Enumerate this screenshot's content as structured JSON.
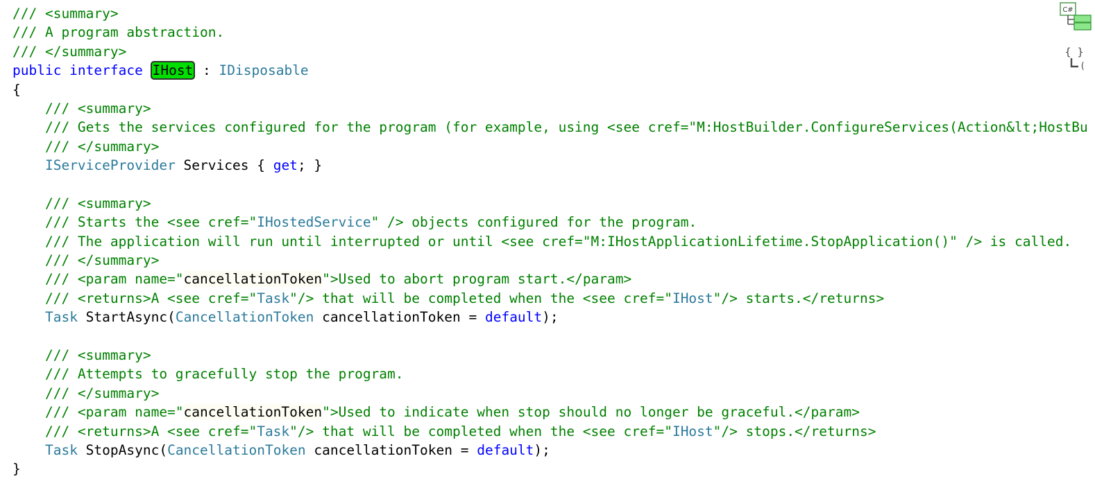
{
  "editor": {
    "language": "C#",
    "file_symbol": "IHost",
    "background_color": "#ffffff",
    "colors": {
      "keyword": "#0000ff",
      "type": "#2b7a9b",
      "comment": "#008000",
      "plain": "#000000",
      "highlight_background": "#00e000",
      "highlight_border": "#303030",
      "xml_name_background": "#fdfdf3"
    }
  },
  "gutter": {
    "icons": [
      {
        "name": "csharp-codemap-icon",
        "label": "C#"
      },
      {
        "name": "braces-structure-icon",
        "label": "{ }"
      }
    ]
  },
  "code": {
    "lines": [
      {
        "index": 1,
        "indent": 0,
        "text": "/// <summary>",
        "tokens": [
          {
            "kind": "comment",
            "text": "/// <summary>"
          }
        ]
      },
      {
        "index": 2,
        "indent": 0,
        "text": "/// A program abstraction.",
        "tokens": [
          {
            "kind": "comment",
            "text": "/// A program abstraction."
          }
        ]
      },
      {
        "index": 3,
        "indent": 0,
        "text": "/// </summary>",
        "tokens": [
          {
            "kind": "comment",
            "text": "/// </summary>"
          }
        ]
      },
      {
        "index": 4,
        "indent": 0,
        "text": "public interface IHost : IDisposable",
        "tokens": [
          {
            "kind": "keyword",
            "text": "public interface "
          },
          {
            "kind": "highlight",
            "text": "IHost"
          },
          {
            "kind": "plain",
            "text": " : "
          },
          {
            "kind": "type",
            "text": "IDisposable"
          }
        ]
      },
      {
        "index": 5,
        "indent": 0,
        "text": "{",
        "tokens": [
          {
            "kind": "plain",
            "text": "{"
          }
        ]
      },
      {
        "index": 6,
        "indent": 1,
        "text": "    /// <summary>",
        "tokens": [
          {
            "kind": "comment",
            "text": "    /// <summary>"
          }
        ]
      },
      {
        "index": 7,
        "indent": 1,
        "text": "    /// Gets the services configured for the program (for example, using <see cref=\"M:HostBuilder.ConfigureServices(Action&lt;HostBu",
        "tokens": [
          {
            "kind": "comment",
            "text": "    /// Gets the services configured for the program (for example, using <see cref=\"M:HostBuilder.ConfigureServices(Action&lt;HostBu"
          }
        ]
      },
      {
        "index": 8,
        "indent": 1,
        "text": "    /// </summary>",
        "tokens": [
          {
            "kind": "comment",
            "text": "    /// </summary>"
          }
        ]
      },
      {
        "index": 9,
        "indent": 1,
        "text": "    IServiceProvider Services { get; }",
        "tokens": [
          {
            "kind": "plain",
            "text": "    "
          },
          {
            "kind": "type",
            "text": "IServiceProvider"
          },
          {
            "kind": "plain",
            "text": " Services { "
          },
          {
            "kind": "keyword",
            "text": "get"
          },
          {
            "kind": "plain",
            "text": "; }"
          }
        ]
      },
      {
        "index": 10,
        "indent": 0,
        "text": "",
        "tokens": []
      },
      {
        "index": 11,
        "indent": 1,
        "text": "    /// <summary>",
        "tokens": [
          {
            "kind": "comment",
            "text": "    /// <summary>"
          }
        ]
      },
      {
        "index": 12,
        "indent": 1,
        "text": "    /// Starts the <see cref=\"IHostedService\" /> objects configured for the program.",
        "tokens": [
          {
            "kind": "comment",
            "text": "    /// Starts the <see cref=\""
          },
          {
            "kind": "cref",
            "text": "IHostedService"
          },
          {
            "kind": "comment",
            "text": "\" /> objects configured for the program."
          }
        ]
      },
      {
        "index": 13,
        "indent": 1,
        "text": "    /// The application will run until interrupted or until <see cref=\"M:IHostApplicationLifetime.StopApplication()\" /> is called.",
        "tokens": [
          {
            "kind": "comment",
            "text": "    /// The application will run until interrupted or until <see cref=\"M:IHostApplicationLifetime.StopApplication()\" /> is called."
          }
        ]
      },
      {
        "index": 14,
        "indent": 1,
        "text": "    /// </summary>",
        "tokens": [
          {
            "kind": "comment",
            "text": "    /// </summary>"
          }
        ]
      },
      {
        "index": 15,
        "indent": 1,
        "text": "    /// <param name=\"cancellationToken\">Used to abort program start.</param>",
        "tokens": [
          {
            "kind": "comment",
            "text": "    /// <param name=\""
          },
          {
            "kind": "xmlname",
            "text": "cancellationToken"
          },
          {
            "kind": "comment",
            "text": "\">Used to abort program start.</param>"
          }
        ]
      },
      {
        "index": 16,
        "indent": 1,
        "text": "    /// <returns>A <see cref=\"Task\"/> that will be completed when the <see cref=\"IHost\"/> starts.</returns>",
        "tokens": [
          {
            "kind": "comment",
            "text": "    /// <returns>A <see cref=\""
          },
          {
            "kind": "cref",
            "text": "Task"
          },
          {
            "kind": "comment",
            "text": "\"/> that will be completed when the <see cref=\""
          },
          {
            "kind": "cref",
            "text": "IHost"
          },
          {
            "kind": "comment",
            "text": "\"/> starts.</returns>"
          }
        ]
      },
      {
        "index": 17,
        "indent": 1,
        "text": "    Task StartAsync(CancellationToken cancellationToken = default);",
        "tokens": [
          {
            "kind": "plain",
            "text": "    "
          },
          {
            "kind": "type",
            "text": "Task"
          },
          {
            "kind": "plain",
            "text": " StartAsync("
          },
          {
            "kind": "type",
            "text": "CancellationToken"
          },
          {
            "kind": "plain",
            "text": " cancellationToken = "
          },
          {
            "kind": "keyword",
            "text": "default"
          },
          {
            "kind": "plain",
            "text": ");"
          }
        ]
      },
      {
        "index": 18,
        "indent": 0,
        "text": "",
        "tokens": []
      },
      {
        "index": 19,
        "indent": 1,
        "text": "    /// <summary>",
        "tokens": [
          {
            "kind": "comment",
            "text": "    /// <summary>"
          }
        ]
      },
      {
        "index": 20,
        "indent": 1,
        "text": "    /// Attempts to gracefully stop the program.",
        "tokens": [
          {
            "kind": "comment",
            "text": "    /// Attempts to gracefully stop the program."
          }
        ]
      },
      {
        "index": 21,
        "indent": 1,
        "text": "    /// </summary>",
        "tokens": [
          {
            "kind": "comment",
            "text": "    /// </summary>"
          }
        ]
      },
      {
        "index": 22,
        "indent": 1,
        "text": "    /// <param name=\"cancellationToken\">Used to indicate when stop should no longer be graceful.</param>",
        "tokens": [
          {
            "kind": "comment",
            "text": "    /// <param name=\""
          },
          {
            "kind": "xmlname",
            "text": "cancellationToken"
          },
          {
            "kind": "comment",
            "text": "\">Used to indicate when stop should no longer be graceful.</param>"
          }
        ]
      },
      {
        "index": 23,
        "indent": 1,
        "text": "    /// <returns>A <see cref=\"Task\"/> that will be completed when the <see cref=\"IHost\"/> stops.</returns>",
        "tokens": [
          {
            "kind": "comment",
            "text": "    /// <returns>A <see cref=\""
          },
          {
            "kind": "cref",
            "text": "Task"
          },
          {
            "kind": "comment",
            "text": "\"/> that will be completed when the <see cref=\""
          },
          {
            "kind": "cref",
            "text": "IHost"
          },
          {
            "kind": "comment",
            "text": "\"/> stops.</returns>"
          }
        ]
      },
      {
        "index": 24,
        "indent": 1,
        "text": "    Task StopAsync(CancellationToken cancellationToken = default);",
        "tokens": [
          {
            "kind": "plain",
            "text": "    "
          },
          {
            "kind": "type",
            "text": "Task"
          },
          {
            "kind": "plain",
            "text": " StopAsync("
          },
          {
            "kind": "type",
            "text": "CancellationToken"
          },
          {
            "kind": "plain",
            "text": " cancellationToken = "
          },
          {
            "kind": "keyword",
            "text": "default"
          },
          {
            "kind": "plain",
            "text": ");"
          }
        ]
      },
      {
        "index": 25,
        "indent": 0,
        "text": "}",
        "tokens": [
          {
            "kind": "plain",
            "text": "}"
          }
        ]
      }
    ]
  }
}
